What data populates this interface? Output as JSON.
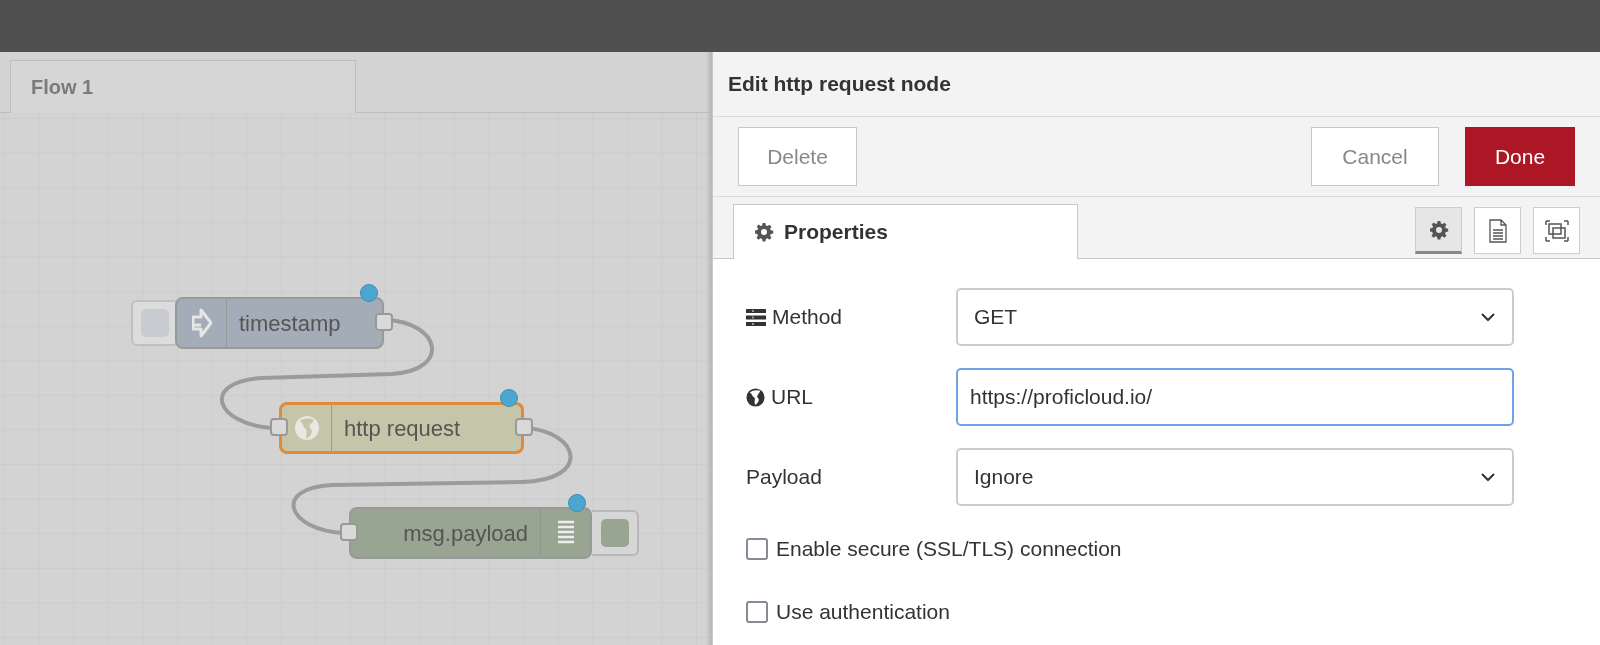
{
  "workspace_tabs": [
    {
      "label": "Flow 1",
      "selected": true
    }
  ],
  "nodes": [
    {
      "kind": "inject",
      "label": "timestamp",
      "selected": false,
      "changed": true
    },
    {
      "kind": "http",
      "label": "http request",
      "selected": true,
      "changed": true
    },
    {
      "kind": "debug",
      "label": "msg.payload",
      "selected": false,
      "changed": true
    }
  ],
  "editor": {
    "title": "Edit http request node",
    "buttons": [
      {
        "kind": "delete",
        "label": "Delete"
      },
      {
        "kind": "cancel",
        "label": "Cancel"
      },
      {
        "kind": "done",
        "label": "Done"
      }
    ],
    "tabs": [
      {
        "label": "Properties",
        "selected": true
      }
    ],
    "icon_tabs": [
      {
        "kind": "settings",
        "selected": true
      },
      {
        "kind": "description",
        "selected": false
      },
      {
        "kind": "appearance",
        "selected": false
      }
    ],
    "fields": [
      {
        "kind": "select",
        "label": "Method",
        "value": "GET",
        "focused": false
      },
      {
        "kind": "text",
        "label": "URL",
        "value": "https://proficloud.io/",
        "focused": true
      },
      {
        "kind": "select",
        "label": "Payload",
        "value": "Ignore",
        "focused": false
      },
      {
        "kind": "checkbox",
        "label": "Enable secure (SSL/TLS) connection",
        "checked": false
      },
      {
        "kind": "checkbox",
        "label": "Use authentication",
        "checked": false
      }
    ]
  }
}
